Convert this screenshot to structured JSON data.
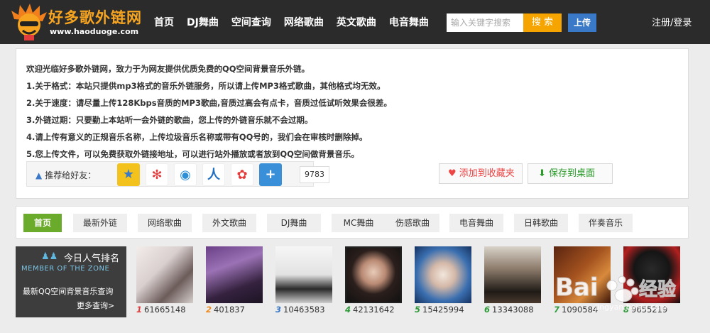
{
  "header": {
    "logo_name": "好多歌外链网",
    "logo_url": "www.haoduoge.com",
    "nav": [
      "首页",
      "DJ舞曲",
      "空间查询",
      "网络歌曲",
      "英文歌曲",
      "电音舞曲"
    ],
    "search_placeholder": "输入关键字搜索",
    "search_label": "搜 索",
    "upload_label": "上传",
    "auth_label": "注册/登录"
  },
  "notice": {
    "lines": [
      "欢迎光临好多歌外链网，致力于为网友提供优质免费的QQ空间背景音乐外链。",
      "1.关于格式：本站只提供mp3格式的音乐外链服务，所以请上传MP3格式歌曲，其他格式均无效。",
      "2.关于速度：请尽量上传128Kbps音质的MP3歌曲,音质过高会有点卡，音质过低试听效果会很差。",
      "3.外链过期：只要勤上本站听一会外链的歌曲，您上传的外链音乐就不会过期。",
      "4.请上传有意义的正规音乐名称，上传垃圾音乐名称或带有QQ号的，我们会在审核时删除掉。",
      "5.您上传文件，可以免费获取外链接地址，可以进行站外播放或者放到QQ空间做背景音乐。"
    ],
    "share_label": "推荐给好友：",
    "share_count": "9783",
    "favorite_label": "添加到收藏夹",
    "desktop_label": "保存到桌面"
  },
  "categories": [
    "首页",
    "最新外链",
    "网络歌曲",
    "外文歌曲",
    "DJ舞曲",
    "MC舞曲",
    "伤感歌曲",
    "电音舞曲",
    "日韩歌曲",
    "伴奏音乐"
  ],
  "ranking": {
    "title": "今日人气排名",
    "subtitle": "MEMBER OF THE ZONE",
    "line": "最新QQ空间背景音乐查询",
    "more": "更多查询>"
  },
  "users": [
    {
      "rank": "1",
      "id": "61665148"
    },
    {
      "rank": "2",
      "id": "401837"
    },
    {
      "rank": "3",
      "id": "10463583"
    },
    {
      "rank": "4",
      "id": "42131642"
    },
    {
      "rank": "5",
      "id": "15425994"
    },
    {
      "rank": "6",
      "id": "13343088"
    },
    {
      "rank": "7",
      "id": "1090584"
    },
    {
      "rank": "8",
      "id": "9655219"
    }
  ],
  "watermark": "Bai经验",
  "watermark_url": "jingyan.baidu.com",
  "colors": {
    "header_bg": "#2b2b2b",
    "logo_orange": "#f7a520",
    "search_orange": "#f5a400",
    "upload_blue": "#3a79c7",
    "active_green": "#6aab2b",
    "rank_colors": [
      "#e43b3b",
      "#f08a1c",
      "#3a79c7",
      "#2e9a3a",
      "#2e9a3a",
      "#2e9a3a",
      "#2e9a3a",
      "#2e9a3a"
    ]
  }
}
